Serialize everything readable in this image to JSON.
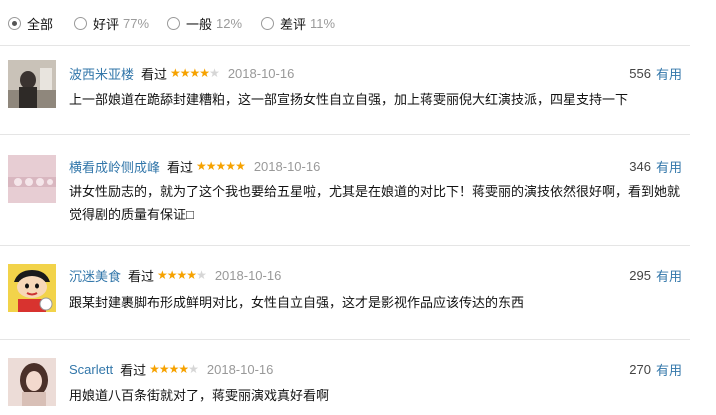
{
  "filters": [
    {
      "label": "全部",
      "pct": "",
      "checked": true
    },
    {
      "label": "好评",
      "pct": "77%",
      "checked": false
    },
    {
      "label": "一般",
      "pct": "12%",
      "checked": false
    },
    {
      "label": "差评",
      "pct": "11%",
      "checked": false
    }
  ],
  "comments": [
    {
      "user": "波西米亚楼",
      "watched": "看过",
      "rating": 4,
      "stars_text": "★★★★",
      "stars_off": "★",
      "date": "2018-10-16",
      "votes": "556",
      "useful_label": "有用",
      "text": "上一部娘道在跪舔封建糟粕，这一部宣扬女性自立自强，加上蒋雯丽倪大红演技派，四星支持一下"
    },
    {
      "user": "横看成岭侧成峰",
      "watched": "看过",
      "rating": 5,
      "stars_text": "★★★★★",
      "stars_off": "",
      "date": "2018-10-16",
      "votes": "346",
      "useful_label": "有用",
      "text": "讲女性励志的，就为了这个我也要给五星啦，尤其是在娘道的对比下！蒋雯丽的演技依然很好啊，看到她就觉得剧的质量有保证□"
    },
    {
      "user": "沉迷美食",
      "watched": "看过",
      "rating": 4,
      "stars_text": "★★★★",
      "stars_off": "★",
      "date": "2018-10-16",
      "votes": "295",
      "useful_label": "有用",
      "text": "跟某封建裹脚布形成鲜明对比，女性自立自强，这才是影视作品应该传达的东西"
    },
    {
      "user": "Scarlett",
      "watched": "看过",
      "rating": 4,
      "stars_text": "★★★★",
      "stars_off": "★",
      "date": "2018-10-16",
      "votes": "270",
      "useful_label": "有用",
      "text": "用娘道八百条街就对了，蒋雯丽演戏真好看啊"
    }
  ],
  "colors": {
    "link": "#3377aa",
    "star": "#f6a200",
    "muted": "#999999"
  }
}
